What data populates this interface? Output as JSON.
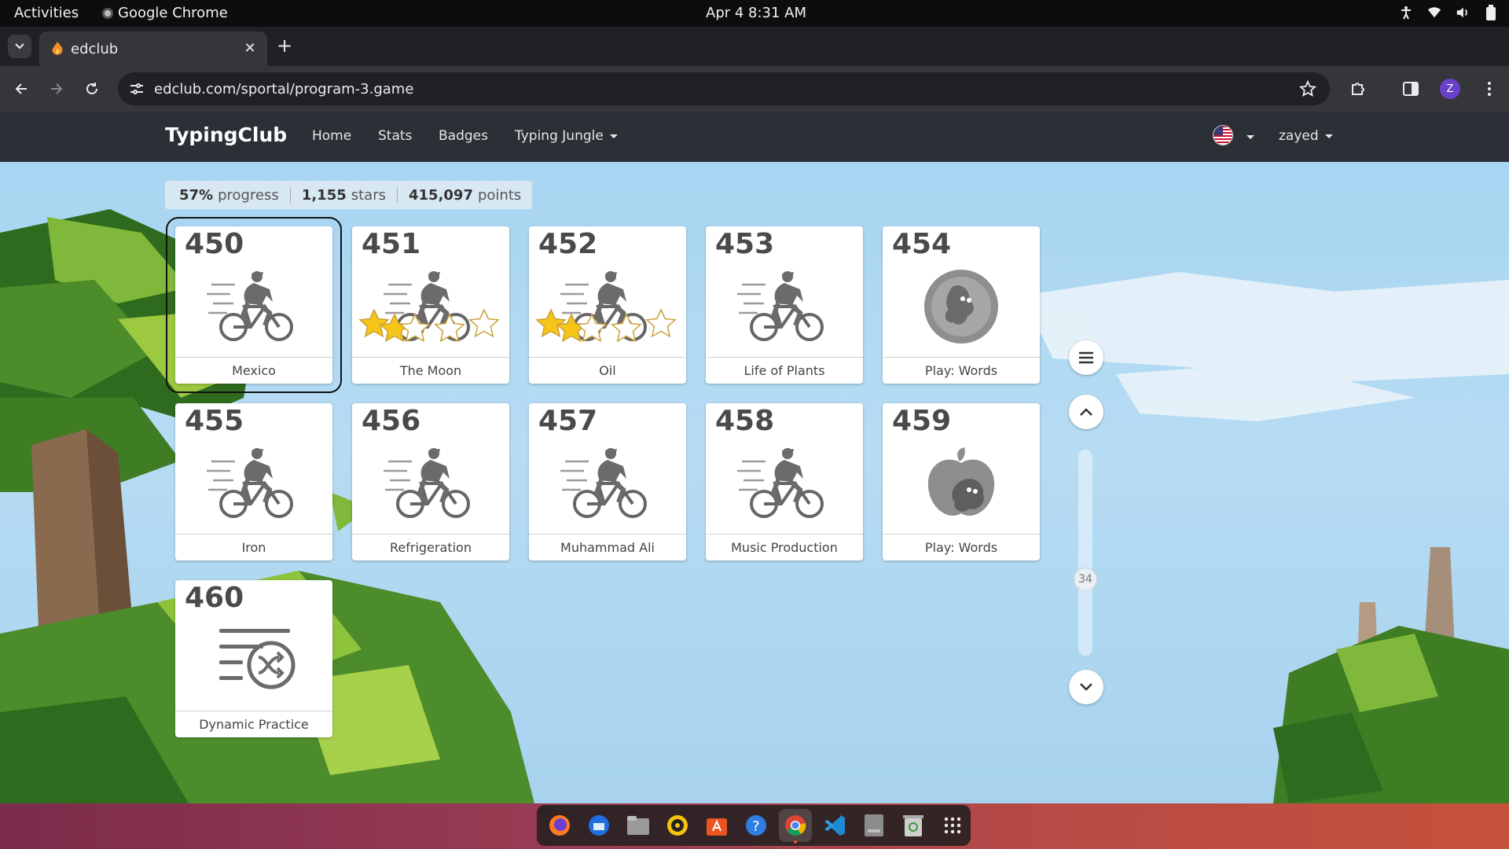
{
  "system": {
    "activities": "Activities",
    "app_name": "Google Chrome",
    "clock": "Apr 4  8:31 AM"
  },
  "browser": {
    "tab_title": "edclub",
    "url": "edclub.com/sportal/program-3.game",
    "profile_initial": "Z"
  },
  "site": {
    "brand": "TypingClub",
    "nav": [
      "Home",
      "Stats",
      "Badges",
      "Typing Jungle"
    ],
    "user": "zayed"
  },
  "stats": {
    "progress_value": "57%",
    "progress_label": "progress",
    "stars_value": "1,155",
    "stars_label": "stars",
    "points_value": "415,097",
    "points_label": "points"
  },
  "lessons": [
    {
      "number": "450",
      "title": "Mexico",
      "icon": "cyclist-icon",
      "stars_earned": 0,
      "selected": true
    },
    {
      "number": "451",
      "title": "The Moon",
      "icon": "cyclist-icon",
      "stars_earned": 1.5
    },
    {
      "number": "452",
      "title": "Oil",
      "icon": "cyclist-icon",
      "stars_earned": 1.5
    },
    {
      "number": "453",
      "title": "Life of Plants",
      "icon": "cyclist-icon",
      "stars_earned": 0
    },
    {
      "number": "454",
      "title": "Play: Words",
      "icon": "game-egg-icon",
      "stars_earned": 0
    },
    {
      "number": "455",
      "title": "Iron",
      "icon": "cyclist-icon",
      "stars_earned": 0
    },
    {
      "number": "456",
      "title": "Refrigeration",
      "icon": "cyclist-icon",
      "stars_earned": 0
    },
    {
      "number": "457",
      "title": "Muhammad Ali",
      "icon": "cyclist-icon",
      "stars_earned": 0
    },
    {
      "number": "458",
      "title": "Music Production",
      "icon": "cyclist-icon",
      "stars_earned": 0
    },
    {
      "number": "459",
      "title": "Play: Words",
      "icon": "game-apple-icon",
      "stars_earned": 0
    },
    {
      "number": "460",
      "title": "Dynamic Practice",
      "icon": "shuffle-practice-icon",
      "stars_earned": 0
    }
  ],
  "scroller": {
    "page_indicator": "34"
  },
  "colors": {
    "site_nav_bg": "#2b3036",
    "sky": "#a8d5f2",
    "star_gold": "#f5c518",
    "icon_gray": "#6b6b6b"
  },
  "dock": [
    "firefox-icon",
    "thunderbird-icon",
    "files-icon",
    "rhythmbox-icon",
    "app-center-icon",
    "help-icon",
    "chrome-icon",
    "vscode-icon",
    "disk-icon",
    "trash-icon",
    "app-grid-icon"
  ]
}
